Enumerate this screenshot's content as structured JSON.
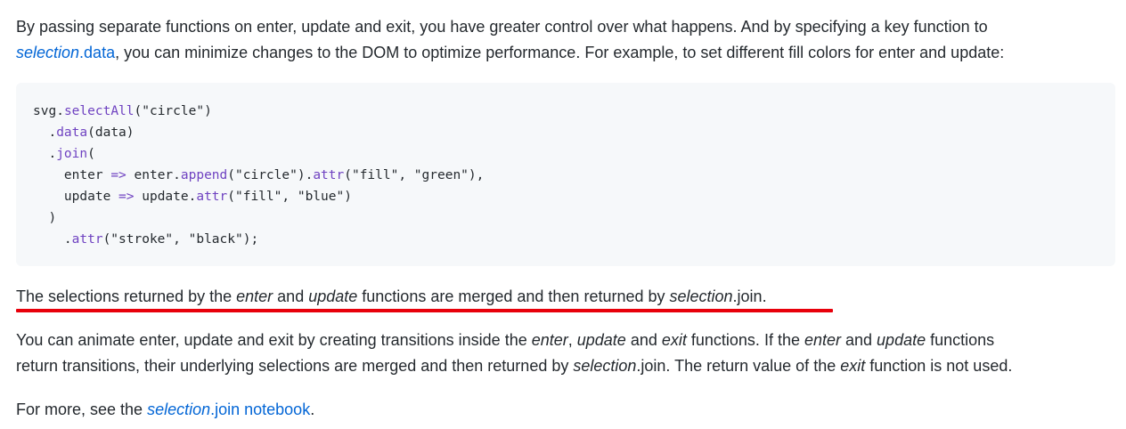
{
  "para1": {
    "line1": "By passing separate functions on enter, update and exit, you have greater control over what happens. And by specifying a key function to",
    "link_selection": "selection",
    "link_data": ".data",
    "line2_rest": ", you can minimize changes to the DOM to optimize performance. For example, to set different fill colors for enter and update:"
  },
  "code": {
    "l1_obj": "svg",
    "l1_dot": ".",
    "l1_fn": "selectAll",
    "l1_arg": "(\"circle\")",
    "l2_dot": "  .",
    "l2_fn": "data",
    "l2_arg": "(data)",
    "l3_dot": "  .",
    "l3_fn": "join",
    "l3_arg": "(",
    "l4_a": "    enter ",
    "l4_arrow": "=>",
    "l4_b": " enter.",
    "l4_fn": "append",
    "l4_c": "(\"circle\").",
    "l4_fn2": "attr",
    "l4_d": "(\"fill\", \"green\"),",
    "l5_a": "    update ",
    "l5_arrow": "=>",
    "l5_b": " update.",
    "l5_fn": "attr",
    "l5_c": "(\"fill\", \"blue\")",
    "l6": "  )",
    "l7_dot": "    .",
    "l7_fn": "attr",
    "l7_arg": "(\"stroke\", \"black\");"
  },
  "para2": {
    "a": "The selections returned by the ",
    "enter": "enter",
    "b": " and ",
    "update": "update",
    "c": " functions are merged and then returned by ",
    "selection": "selection",
    "d": ".join."
  },
  "para3": {
    "a": "You can animate enter, update and exit by creating transitions inside the ",
    "enter": "enter",
    "b": ", ",
    "update": "update",
    "c": " and ",
    "exit": "exit",
    "d": " functions. If the ",
    "enter2": "enter",
    "e": " and ",
    "update2": "update",
    "f": " functions",
    "g": "return transitions, their underlying selections are merged and then returned by ",
    "selection": "selection",
    "h": ".join. The return value of the ",
    "exit2": "exit",
    "i": " function is not used."
  },
  "para4": {
    "a": "For more, see the ",
    "link_selection": "selection",
    "link_rest": ".join notebook",
    "b": "."
  },
  "colors": {
    "link": "#0366d6",
    "code_bg": "#f6f8fa",
    "method": "#6f42c1",
    "underline": "#e8000b"
  }
}
